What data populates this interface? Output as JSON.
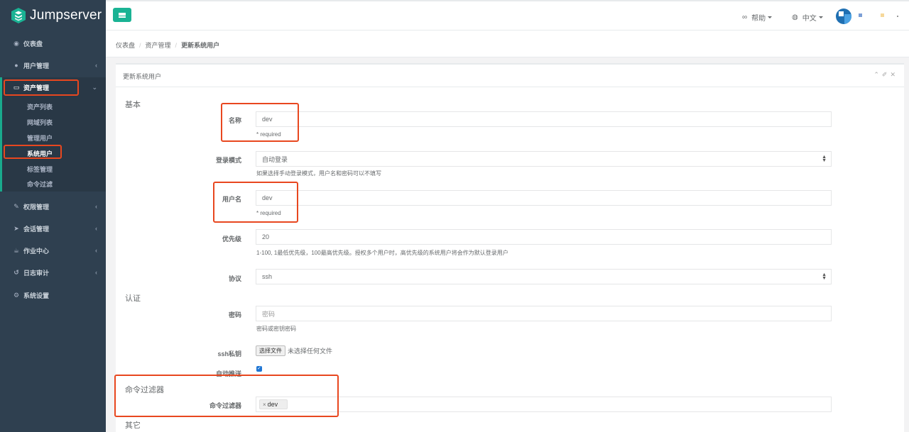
{
  "app": {
    "logo_text": "Jumpserver"
  },
  "sidebar": {
    "items": [
      {
        "label": "仪表盘",
        "icon": "dashboard-icon"
      },
      {
        "label": "用户管理",
        "icon": "users-icon"
      },
      {
        "label": "资产管理",
        "icon": "inbox-icon"
      },
      {
        "label": "权限管理",
        "icon": "edit-icon"
      },
      {
        "label": "会话管理",
        "icon": "rocket-icon"
      },
      {
        "label": "作业中心",
        "icon": "coffee-icon"
      },
      {
        "label": "日志审计",
        "icon": "history-icon"
      },
      {
        "label": "系统设置",
        "icon": "gears-icon"
      }
    ],
    "submenu": [
      "资产列表",
      "网域列表",
      "管理用户",
      "系统用户",
      "标签管理",
      "命令过滤"
    ]
  },
  "topbar": {
    "help": "帮助",
    "language": "中文"
  },
  "breadcrumb": {
    "home": "仪表盘",
    "parent": "资产管理",
    "current": "更新系统用户"
  },
  "panel": {
    "title": "更新系统用户"
  },
  "sections": {
    "basic": "基本",
    "auth": "认证",
    "cmd_filter": "命令过滤器",
    "other": "其它"
  },
  "form": {
    "name": {
      "label": "名称",
      "value": "dev",
      "help": "* required"
    },
    "login_mode": {
      "label": "登录模式",
      "value": "自动登录",
      "help": "如果选择手动登录模式，用户名和密码可以不填写"
    },
    "username": {
      "label": "用户名",
      "value": "dev",
      "help": "* required"
    },
    "priority": {
      "label": "优先级",
      "value": "20",
      "help": "1-100, 1最低优先级，100最高优先级。授权多个用户时，高优先级的系统用户将会作为默认登录用户"
    },
    "protocol": {
      "label": "协议",
      "value": "ssh"
    },
    "password": {
      "label": "密码",
      "placeholder": "密码",
      "help": "密码或密钥密码"
    },
    "ssh_key": {
      "label": "ssh私钥",
      "button": "选择文件",
      "status": "未选择任何文件"
    },
    "auto_push": {
      "label": "自动推送",
      "checked": true
    },
    "cmd_filters": {
      "label": "命令过滤器",
      "tag": "dev"
    }
  },
  "colors": {
    "sidebar_bg": "#2f4050",
    "accent": "#1ab394",
    "highlight": "#e8471f"
  }
}
